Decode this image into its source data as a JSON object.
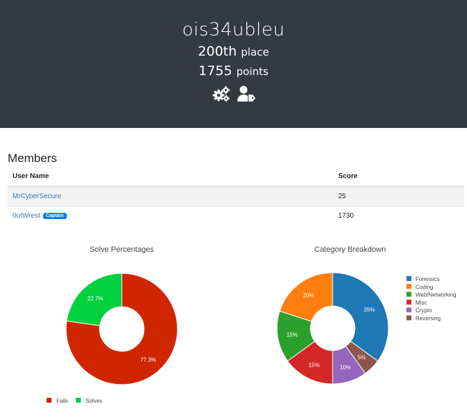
{
  "header": {
    "team_name": "ois34ubleu",
    "place_number": "200th",
    "place_word": "place",
    "points_number": "1755",
    "points_word": "points"
  },
  "members": {
    "title": "Members",
    "columns": [
      "User Name",
      "Score"
    ],
    "rows": [
      {
        "name": "MrCyberSecure",
        "score": "25",
        "badge": ""
      },
      {
        "name": "0utWrest",
        "score": "1730",
        "badge": "Captain"
      }
    ]
  },
  "chart_data": [
    {
      "type": "pie",
      "title": "Solve Percentages",
      "labels": [
        "Fails",
        "Solves"
      ],
      "values": [
        77.3,
        22.7
      ],
      "data_labels": [
        "77.3%",
        "22.7%"
      ],
      "colors": [
        "#cf2600",
        "#00d13f"
      ],
      "donut": true,
      "legend": "bottom-left"
    },
    {
      "type": "pie",
      "title": "Category Breakdown",
      "labels": [
        "Forensics",
        "Coding",
        "Web/Networking",
        "Misc",
        "Crypto",
        "Reversing"
      ],
      "values": [
        35,
        20,
        15,
        15,
        10,
        5
      ],
      "data_labels": [
        "35%",
        "20%",
        "15%",
        "15%",
        "10%",
        "5%"
      ],
      "draw_order": [
        0,
        5,
        4,
        3,
        2,
        1
      ],
      "colors": [
        "#1f77b4",
        "#ff7f0e",
        "#2ca02c",
        "#d62728",
        "#9467bd",
        "#8c564b"
      ],
      "donut": true,
      "legend": "right"
    }
  ]
}
